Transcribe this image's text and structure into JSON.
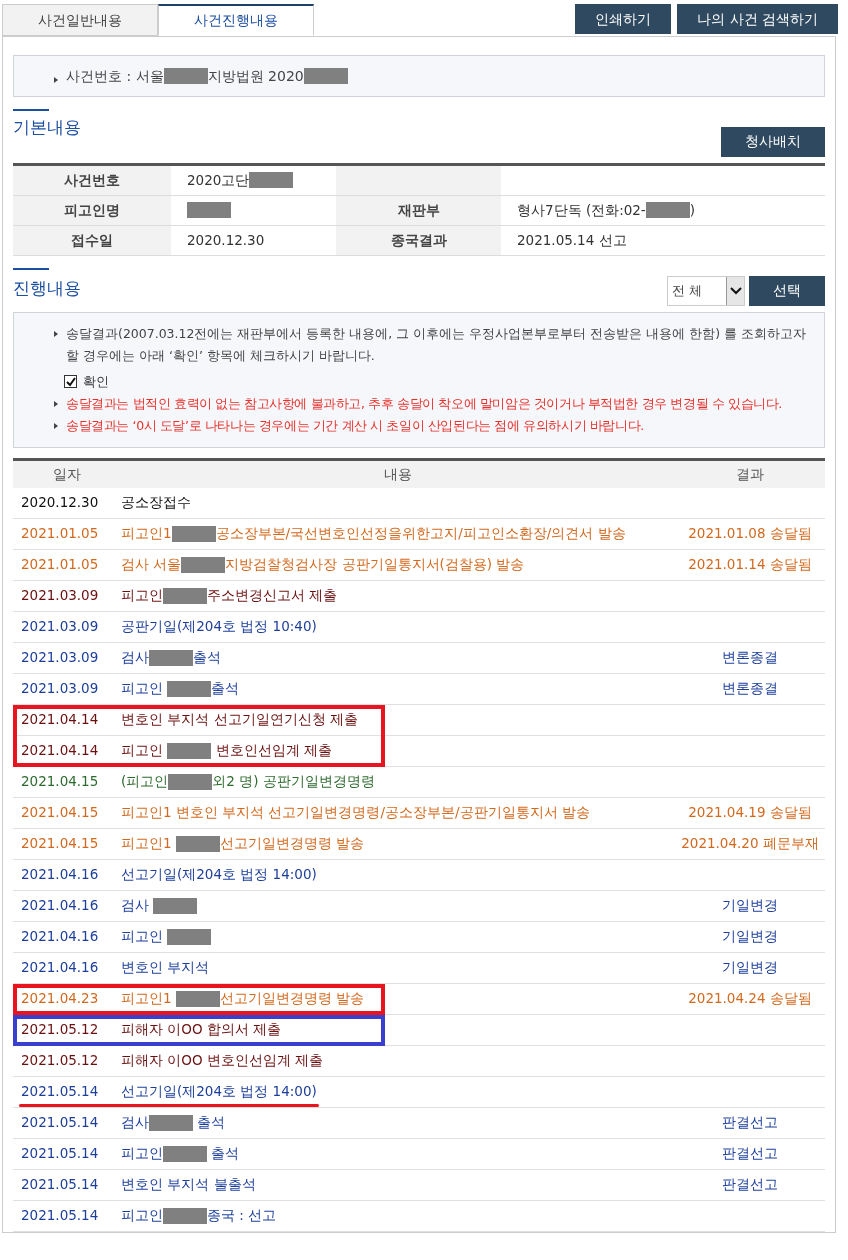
{
  "tabs": [
    {
      "label": "사건일반내용",
      "selected": false
    },
    {
      "label": "사건진행내용",
      "selected": true
    }
  ],
  "top_buttons": [
    "인쇄하기",
    "나의 사건 검색하기"
  ],
  "case_banner": [
    {
      "kind": "text",
      "text": "사건번호 : 서울"
    },
    {
      "kind": "redacted"
    },
    {
      "kind": "text",
      "text": "지방법원 2020"
    },
    {
      "kind": "redacted"
    }
  ],
  "basic": {
    "title": "기본내용",
    "button": "청사배치",
    "rows": [
      [
        {
          "label": "사건번호",
          "value": [
            {
              "kind": "text",
              "text": "2020고단"
            },
            {
              "kind": "redacted"
            }
          ]
        }
      ],
      [
        {
          "label": "피고인명",
          "value": [
            {
              "kind": "redacted"
            }
          ]
        },
        {
          "label": "재판부",
          "value": [
            {
              "kind": "text",
              "text": "형사7단독 (전화:02-"
            },
            {
              "kind": "redacted"
            },
            {
              "kind": "text",
              "text": ")"
            }
          ]
        }
      ],
      [
        {
          "label": "접수일",
          "value": [
            {
              "kind": "text",
              "text": "2020.12.30"
            }
          ]
        },
        {
          "label": "종국결과",
          "value": [
            {
              "kind": "text",
              "text": "2021.05.14 선고"
            }
          ]
        }
      ]
    ]
  },
  "progress": {
    "title": "진행내용",
    "filter": "전 체",
    "button": "선택",
    "notices": [
      {
        "kind": "normal",
        "text": "송달결과(2007.03.12전에는 재판부에서 등록한 내용에, 그 이후에는 우정사업본부로부터 전송받은 내용에 한함) 를 조회하고자 할 경우에는 아래 ‘확인’ 항목에 체크하시기 바랍니다."
      },
      {
        "kind": "checkbox",
        "text": "확인",
        "checked": true
      },
      {
        "kind": "warning",
        "text": "송달결과는 법적인 효력이 없는 참고사항에 불과하고, 추후 송달이 착오에 말미암은 것이거나 부적법한 경우 변경될 수 있습니다."
      },
      {
        "kind": "warning",
        "text": "송달결과는 ‘0시 도달’로 나타나는 경우에는 기간 계산 시 초일이 산입된다는 점에 유의하시기 바랍니다."
      }
    ],
    "columns": [
      "일자",
      "내용",
      "결과"
    ],
    "rows": [
      {
        "kind": "received",
        "date": "2020.12.30",
        "parts": [
          {
            "kind": "text",
            "text": "공소장접수"
          }
        ]
      },
      {
        "kind": "sent",
        "date": "2021.01.05",
        "parts": [
          {
            "kind": "text",
            "text": "피고인1"
          },
          {
            "kind": "redacted"
          },
          {
            "kind": "text",
            "text": "공소장부본/국선변호인선정을위한고지/피고인소환장/의견서 발송"
          }
        ],
        "result": "2021.01.08 송달됨"
      },
      {
        "kind": "sent",
        "date": "2021.01.05",
        "parts": [
          {
            "kind": "text",
            "text": "검사 서울"
          },
          {
            "kind": "redacted"
          },
          {
            "kind": "text",
            "text": "지방검찰청검사장 공판기일통지서(검찰용) 발송"
          }
        ],
        "result": "2021.01.14 송달됨"
      },
      {
        "kind": "filed",
        "date": "2021.03.09",
        "parts": [
          {
            "kind": "text",
            "text": "피고인"
          },
          {
            "kind": "redacted"
          },
          {
            "kind": "text",
            "text": "주소변경신고서 제출"
          }
        ]
      },
      {
        "kind": "hearing",
        "date": "2021.03.09",
        "parts": [
          {
            "kind": "text",
            "text": "공판기일(제204호 법정 10:40)"
          }
        ]
      },
      {
        "kind": "hearing",
        "date": "2021.03.09",
        "parts": [
          {
            "kind": "text",
            "text": "검사"
          },
          {
            "kind": "redacted"
          },
          {
            "kind": "text",
            "text": "출석"
          }
        ],
        "result": "변론종결"
      },
      {
        "kind": "hearing",
        "date": "2021.03.09",
        "parts": [
          {
            "kind": "text",
            "text": "피고인 "
          },
          {
            "kind": "redacted"
          },
          {
            "kind": "text",
            "text": "출석"
          }
        ],
        "result": "변론종결"
      },
      {
        "kind": "filed",
        "date": "2021.04.14",
        "parts": [
          {
            "kind": "text",
            "text": "변호인 부지석 선고기일연기신청 제출"
          }
        ],
        "annotation": {
          "kind": "box",
          "color": "#e8141f"
        }
      },
      {
        "kind": "filed",
        "date": "2021.04.14",
        "parts": [
          {
            "kind": "text",
            "text": "피고인 "
          },
          {
            "kind": "redacted"
          },
          {
            "kind": "text",
            "text": " 변호인선임계 제출"
          }
        ],
        "annotation": {
          "kind": "box",
          "color": "#e8141f"
        }
      },
      {
        "kind": "order",
        "date": "2021.04.15",
        "parts": [
          {
            "kind": "text",
            "text": "(피고인"
          },
          {
            "kind": "redacted"
          },
          {
            "kind": "text",
            "text": "외2 명) 공판기일변경명령"
          }
        ]
      },
      {
        "kind": "sent",
        "date": "2021.04.15",
        "parts": [
          {
            "kind": "text",
            "text": "피고인1 변호인 부지석 선고기일변경명령/공소장부본/공판기일통지서 발송"
          }
        ],
        "result": "2021.04.19 송달됨"
      },
      {
        "kind": "sent",
        "date": "2021.04.15",
        "parts": [
          {
            "kind": "text",
            "text": "피고인1 "
          },
          {
            "kind": "redacted"
          },
          {
            "kind": "text",
            "text": "선고기일변경명령 발송"
          }
        ],
        "result": "2021.04.20 폐문부재"
      },
      {
        "kind": "hearing",
        "date": "2021.04.16",
        "parts": [
          {
            "kind": "text",
            "text": "선고기일(제204호 법정 14:00)"
          }
        ]
      },
      {
        "kind": "hearing",
        "date": "2021.04.16",
        "parts": [
          {
            "kind": "text",
            "text": "검사 "
          },
          {
            "kind": "redacted"
          }
        ],
        "result": "기일변경"
      },
      {
        "kind": "hearing",
        "date": "2021.04.16",
        "parts": [
          {
            "kind": "text",
            "text": "피고인 "
          },
          {
            "kind": "redacted"
          }
        ],
        "result": "기일변경"
      },
      {
        "kind": "hearing",
        "date": "2021.04.16",
        "parts": [
          {
            "kind": "text",
            "text": "변호인 부지석"
          }
        ],
        "result": "기일변경"
      },
      {
        "kind": "sent",
        "date": "2021.04.23",
        "parts": [
          {
            "kind": "text",
            "text": "피고인1 "
          },
          {
            "kind": "redacted"
          },
          {
            "kind": "text",
            "text": "선고기일변경명령 발송"
          }
        ],
        "result": "2021.04.24 송달됨",
        "annotation": {
          "kind": "box",
          "color": "#e8141f"
        }
      },
      {
        "kind": "filed",
        "date": "2021.05.12",
        "parts": [
          {
            "kind": "text",
            "text": "피해자 이OO 합의서 제출"
          }
        ],
        "annotation": {
          "kind": "box",
          "color": "#3b3fce"
        }
      },
      {
        "kind": "filed",
        "date": "2021.05.12",
        "parts": [
          {
            "kind": "text",
            "text": "피해자 이OO 변호인선임계 제출"
          }
        ]
      },
      {
        "kind": "hearing",
        "date": "2021.05.14",
        "parts": [
          {
            "kind": "text",
            "text": "선고기일(제204호 법정 14:00)"
          }
        ],
        "annotation": {
          "kind": "underline",
          "color": "#e8141f"
        }
      },
      {
        "kind": "hearing",
        "date": "2021.05.14",
        "parts": [
          {
            "kind": "text",
            "text": "검사"
          },
          {
            "kind": "redacted"
          },
          {
            "kind": "text",
            "text": " 출석"
          }
        ],
        "result": "판결선고"
      },
      {
        "kind": "hearing",
        "date": "2021.05.14",
        "parts": [
          {
            "kind": "text",
            "text": "피고인"
          },
          {
            "kind": "redacted"
          },
          {
            "kind": "text",
            "text": " 출석"
          }
        ],
        "result": "판결선고"
      },
      {
        "kind": "hearing",
        "date": "2021.05.14",
        "parts": [
          {
            "kind": "text",
            "text": "변호인 부지석 불출석"
          }
        ],
        "result": "판결선고"
      },
      {
        "kind": "hearing",
        "date": "2021.05.14",
        "parts": [
          {
            "kind": "text",
            "text": "피고인"
          },
          {
            "kind": "redacted"
          },
          {
            "kind": "text",
            "text": "종국 : 선고"
          }
        ]
      }
    ]
  }
}
